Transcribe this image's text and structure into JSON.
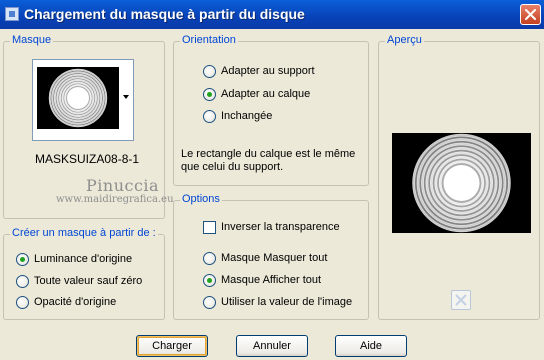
{
  "window": {
    "title": "Chargement du masque à partir du disque"
  },
  "masque": {
    "label": "Masque",
    "mask_name": "MASKSUIZA08-8-1"
  },
  "watermark": {
    "line1": "Pinuccia",
    "line2": "www.maidiregrafica.eu"
  },
  "orientation": {
    "label": "Orientation",
    "options": [
      {
        "label": "Adapter au support",
        "checked": false
      },
      {
        "label": "Adapter au calque",
        "checked": true
      },
      {
        "label": "Inchangée",
        "checked": false
      }
    ],
    "info": "Le rectangle du calque est le même que celui du support."
  },
  "creer": {
    "label": "Créer un masque à partir de :",
    "options": [
      {
        "label": "Luminance d'origine",
        "checked": true
      },
      {
        "label": "Toute valeur sauf zéro",
        "checked": false
      },
      {
        "label": "Opacité d'origine",
        "checked": false
      }
    ]
  },
  "options": {
    "label": "Options",
    "invert_label": "Inverser la transparence",
    "invert_checked": false,
    "radios": [
      {
        "label": "Masque Masquer tout",
        "checked": false
      },
      {
        "label": "Masque Afficher tout",
        "checked": true
      },
      {
        "label": "Utiliser la valeur de l'image",
        "checked": false
      }
    ]
  },
  "apercu": {
    "label": "Aperçu"
  },
  "buttons": {
    "charger": "Charger",
    "annuler": "Annuler",
    "aide": "Aide"
  },
  "colors": {
    "title_bar": "#0842b8",
    "group_label": "#0046d5",
    "window_bg": "#ece9d8"
  }
}
